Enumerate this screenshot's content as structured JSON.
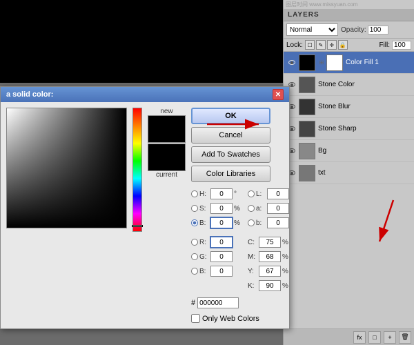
{
  "background": {
    "color": "#6b6b6b"
  },
  "layers_panel": {
    "title": "LAYERS",
    "blend_mode": "Normal",
    "opacity_label": "Opacity:",
    "opacity_value": "100",
    "lock_label": "Lock:",
    "fill_label": "Fill:",
    "fill_value": "100",
    "layers": [
      {
        "id": "color-fill-1",
        "label": "Color Fill 1",
        "active": true
      },
      {
        "id": "stone-color",
        "label": "Stone Color",
        "active": false
      },
      {
        "id": "stone-blur",
        "label": "Stone Blur",
        "active": false
      },
      {
        "id": "stone-sharp",
        "label": "Stone Sharp",
        "active": false
      },
      {
        "id": "bg",
        "label": "Bg",
        "active": false
      },
      {
        "id": "txt",
        "label": "txt",
        "active": false
      }
    ],
    "bottom_icons": [
      "fx-icon",
      "mask-icon",
      "new-layer-icon",
      "delete-icon"
    ]
  },
  "color_dialog": {
    "title": "a solid color:",
    "buttons": {
      "ok": "OK",
      "cancel": "Cancel",
      "add_to_swatches": "Add To Swatches",
      "color_libraries": "Color Libraries"
    },
    "fields": {
      "H": {
        "label": "H:",
        "value": "0",
        "unit": "°"
      },
      "S": {
        "label": "S:",
        "value": "0",
        "unit": "%"
      },
      "B": {
        "label": "B:",
        "value": "0",
        "unit": "%",
        "checked": true
      },
      "L": {
        "label": "L:",
        "value": "0",
        "unit": ""
      },
      "a": {
        "label": "a:",
        "value": "0",
        "unit": ""
      },
      "b_field": {
        "label": "b:",
        "value": "0",
        "unit": ""
      },
      "R": {
        "label": "R:",
        "value": "0",
        "unit": ""
      },
      "G": {
        "label": "G:",
        "value": "0",
        "unit": ""
      },
      "B2": {
        "label": "B:",
        "value": "0",
        "unit": ""
      },
      "C": {
        "label": "C:",
        "value": "75",
        "unit": "%"
      },
      "M": {
        "label": "M:",
        "value": "68",
        "unit": "%"
      },
      "Y": {
        "label": "Y:",
        "value": "67",
        "unit": "%"
      },
      "K": {
        "label": "K:",
        "value": "90",
        "unit": "%"
      }
    },
    "hex_label": "#",
    "hex_value": "000000",
    "web_colors_label": "Only Web Colors",
    "preview_new_label": "new",
    "preview_current_label": "current"
  }
}
